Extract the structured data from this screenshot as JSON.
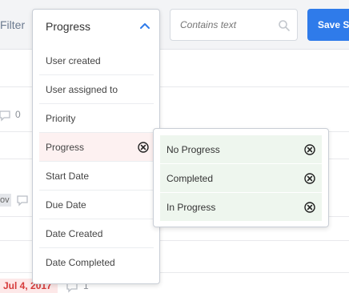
{
  "toolbar": {
    "filter_label": "Filter",
    "search_placeholder": "Contains text",
    "save_label": "Save Se"
  },
  "dropdown": {
    "selected": "Progress",
    "items": [
      {
        "label": "User created"
      },
      {
        "label": "User assigned to"
      },
      {
        "label": "Priority"
      },
      {
        "label": "Progress",
        "active": true
      },
      {
        "label": "Start Date"
      },
      {
        "label": "Due Date"
      },
      {
        "label": "Date Created"
      },
      {
        "label": "Date Completed"
      }
    ]
  },
  "submenu": {
    "items": [
      {
        "label": "No Progress"
      },
      {
        "label": "Completed"
      },
      {
        "label": "In Progress"
      }
    ]
  },
  "background": {
    "comment_count_1": "0",
    "tag_text": "ov",
    "due_date": "Jul 4, 2017",
    "comment_count_2": "1"
  },
  "colors": {
    "accent": "#2f7bea",
    "active_row": "#fdf1f1",
    "submenu_row": "#eef6ee",
    "overdue": "#d63b3b"
  }
}
